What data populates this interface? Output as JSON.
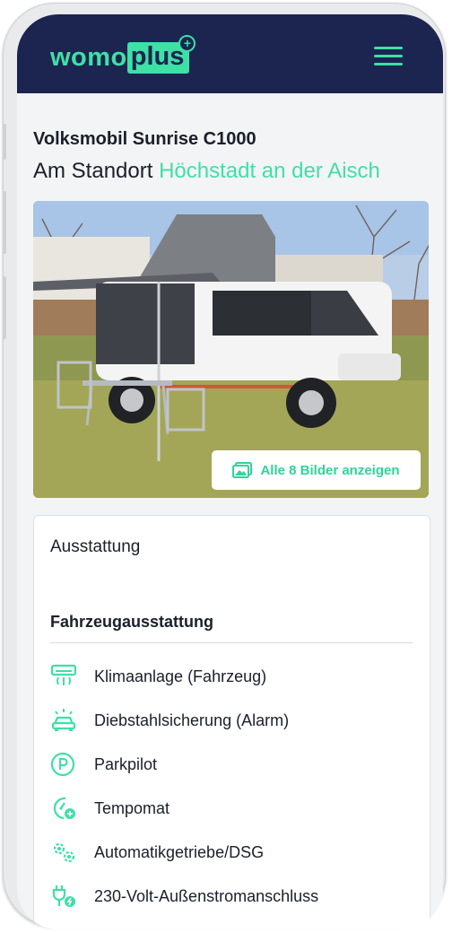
{
  "header": {
    "logo_left": "womo",
    "logo_right": "plus",
    "logo_plus": "+"
  },
  "vehicle": {
    "name": "Volksmobil Sunrise C1000",
    "location_prefix": "Am Standort",
    "location_city": "Höchstadt an der Aisch"
  },
  "gallery": {
    "button_label": "Alle 8 Bilder anzeigen"
  },
  "equipment": {
    "title": "Ausstattung",
    "section_title": "Fahrzeugausstattung",
    "items": [
      {
        "label": "Klimaanlage (Fahrzeug)",
        "icon": "air-conditioning-icon"
      },
      {
        "label": "Diebstahlsicherung (Alarm)",
        "icon": "car-alarm-icon"
      },
      {
        "label": "Parkpilot",
        "icon": "parking-icon"
      },
      {
        "label": "Tempomat",
        "icon": "cruise-control-icon"
      },
      {
        "label": "Automatikgetriebe/DSG",
        "icon": "gears-icon"
      },
      {
        "label": "230-Volt-Außenstromanschluss",
        "icon": "power-plug-icon"
      }
    ]
  },
  "colors": {
    "accent": "#3ee0a6",
    "header_bg": "#1c2450",
    "text": "#1b1f2a"
  }
}
